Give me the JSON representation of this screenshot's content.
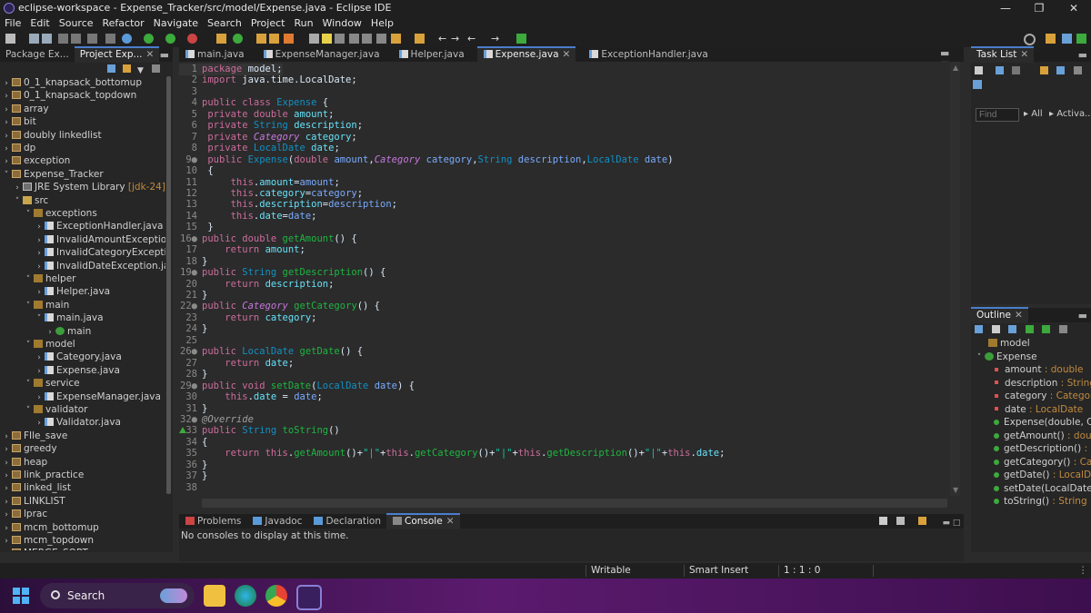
{
  "window": {
    "title": "eclipse-workspace - Expense_Tracker/src/model/Expense.java - Eclipse IDE"
  },
  "menu": [
    "File",
    "Edit",
    "Source",
    "Refactor",
    "Navigate",
    "Search",
    "Project",
    "Run",
    "Window",
    "Help"
  ],
  "left_tabs": {
    "package_explorer": "Package Ex...",
    "project_explorer": "Project Exp..."
  },
  "tree": [
    {
      "indent": 0,
      "chev": ">",
      "icon": "proj",
      "label": "0_1_knapsack_bottomup"
    },
    {
      "indent": 0,
      "chev": ">",
      "icon": "proj",
      "label": "0_1_knapsack_topdown"
    },
    {
      "indent": 0,
      "chev": ">",
      "icon": "proj",
      "label": "array"
    },
    {
      "indent": 0,
      "chev": ">",
      "icon": "proj",
      "label": "bit"
    },
    {
      "indent": 0,
      "chev": ">",
      "icon": "proj",
      "label": "doubly linkedlist"
    },
    {
      "indent": 0,
      "chev": ">",
      "icon": "proj",
      "label": "dp"
    },
    {
      "indent": 0,
      "chev": ">",
      "icon": "proj",
      "label": "exception"
    },
    {
      "indent": 0,
      "chev": "v",
      "icon": "proj",
      "label": "Expense_Tracker"
    },
    {
      "indent": 1,
      "chev": ">",
      "icon": "lib",
      "label": "JRE System Library",
      "extra": " [jdk-24]"
    },
    {
      "indent": 1,
      "chev": "v",
      "icon": "folder",
      "label": "src"
    },
    {
      "indent": 2,
      "chev": "v",
      "icon": "pkg",
      "label": "exceptions"
    },
    {
      "indent": 3,
      "chev": ">",
      "icon": "java",
      "label": "ExceptionHandler.java"
    },
    {
      "indent": 3,
      "chev": ">",
      "icon": "java",
      "label": "InvalidAmountException.jav"
    },
    {
      "indent": 3,
      "chev": ">",
      "icon": "java",
      "label": "InvalidCategoryException.ja"
    },
    {
      "indent": 3,
      "chev": ">",
      "icon": "java",
      "label": "InvalidDateException.java"
    },
    {
      "indent": 2,
      "chev": "v",
      "icon": "pkg",
      "label": "helper"
    },
    {
      "indent": 3,
      "chev": ">",
      "icon": "java",
      "label": "Helper.java"
    },
    {
      "indent": 2,
      "chev": "v",
      "icon": "pkg",
      "label": "main"
    },
    {
      "indent": 3,
      "chev": "v",
      "icon": "java",
      "label": "main.java"
    },
    {
      "indent": 4,
      "chev": ">",
      "icon": "cls",
      "label": "main"
    },
    {
      "indent": 2,
      "chev": "v",
      "icon": "pkg",
      "label": "model"
    },
    {
      "indent": 3,
      "chev": ">",
      "icon": "java",
      "label": "Category.java"
    },
    {
      "indent": 3,
      "chev": ">",
      "icon": "java",
      "label": "Expense.java"
    },
    {
      "indent": 2,
      "chev": "v",
      "icon": "pkg",
      "label": "service"
    },
    {
      "indent": 3,
      "chev": ">",
      "icon": "java",
      "label": "ExpenseManager.java"
    },
    {
      "indent": 2,
      "chev": "v",
      "icon": "pkg",
      "label": "validator"
    },
    {
      "indent": 3,
      "chev": ">",
      "icon": "java",
      "label": "Validator.java"
    },
    {
      "indent": 0,
      "chev": ">",
      "icon": "proj",
      "label": "FIle_save"
    },
    {
      "indent": 0,
      "chev": ">",
      "icon": "proj",
      "label": "greedy"
    },
    {
      "indent": 0,
      "chev": ">",
      "icon": "proj",
      "label": "heap"
    },
    {
      "indent": 0,
      "chev": ">",
      "icon": "proj",
      "label": "link_practice"
    },
    {
      "indent": 0,
      "chev": ">",
      "icon": "proj",
      "label": "linked_list"
    },
    {
      "indent": 0,
      "chev": ">",
      "icon": "proj",
      "label": "LINKLIST"
    },
    {
      "indent": 0,
      "chev": ">",
      "icon": "proj",
      "label": "lprac"
    },
    {
      "indent": 0,
      "chev": ">",
      "icon": "proj",
      "label": "mcm_bottomup"
    },
    {
      "indent": 0,
      "chev": ">",
      "icon": "proj",
      "label": "mcm_topdown"
    },
    {
      "indent": 0,
      "chev": ">",
      "icon": "proj",
      "label": "MERGE_SORT"
    }
  ],
  "editor_tabs": [
    {
      "label": "main.java",
      "active": false
    },
    {
      "label": "ExpenseManager.java",
      "active": false
    },
    {
      "label": "Helper.java",
      "active": false
    },
    {
      "label": "Expense.java",
      "active": true
    },
    {
      "label": "ExceptionHandler.java",
      "active": false
    }
  ],
  "code": [
    {
      "n": "1",
      "t": [
        [
          "kw",
          "package"
        ],
        [
          "pln",
          " model;"
        ]
      ]
    },
    {
      "n": "2",
      "t": [
        [
          "kw",
          "import"
        ],
        [
          "pln",
          " java.time.LocalDate;"
        ]
      ]
    },
    {
      "n": "3",
      "t": []
    },
    {
      "n": "4",
      "t": [
        [
          "kw",
          "public class"
        ],
        [
          "pln",
          " "
        ],
        [
          "ty",
          "Expense"
        ],
        [
          "pln",
          " {"
        ]
      ]
    },
    {
      "n": "5",
      "t": [
        [
          "pln",
          " "
        ],
        [
          "kw",
          "private double"
        ],
        [
          "pln",
          " "
        ],
        [
          "fld",
          "amount"
        ],
        [
          "pln",
          ";"
        ]
      ]
    },
    {
      "n": "6",
      "t": [
        [
          "pln",
          " "
        ],
        [
          "kw",
          "private"
        ],
        [
          "pln",
          " "
        ],
        [
          "ty",
          "String"
        ],
        [
          "pln",
          " "
        ],
        [
          "fld",
          "description"
        ],
        [
          "pln",
          ";"
        ]
      ]
    },
    {
      "n": "7",
      "t": [
        [
          "pln",
          " "
        ],
        [
          "kw",
          "private"
        ],
        [
          "pln",
          " "
        ],
        [
          "tyi",
          "Category"
        ],
        [
          "pln",
          " "
        ],
        [
          "fld",
          "category"
        ],
        [
          "pln",
          ";"
        ]
      ]
    },
    {
      "n": "8",
      "t": [
        [
          "pln",
          " "
        ],
        [
          "kw",
          "private"
        ],
        [
          "pln",
          " "
        ],
        [
          "ty",
          "LocalDate"
        ],
        [
          "pln",
          " "
        ],
        [
          "fld",
          "date"
        ],
        [
          "pln",
          ";"
        ]
      ]
    },
    {
      "n": "9●",
      "t": [
        [
          "pln",
          " "
        ],
        [
          "kw",
          "public"
        ],
        [
          "pln",
          " "
        ],
        [
          "ty",
          "Expense"
        ],
        [
          "pln",
          "("
        ],
        [
          "kw",
          "double"
        ],
        [
          "pln",
          " "
        ],
        [
          "par",
          "amount"
        ],
        [
          "pln",
          ","
        ],
        [
          "tyi",
          "Category"
        ],
        [
          "pln",
          " "
        ],
        [
          "par",
          "category"
        ],
        [
          "pln",
          ","
        ],
        [
          "ty",
          "String"
        ],
        [
          "pln",
          " "
        ],
        [
          "par",
          "description"
        ],
        [
          "pln",
          ","
        ],
        [
          "ty",
          "LocalDate"
        ],
        [
          "pln",
          " "
        ],
        [
          "par",
          "date"
        ],
        [
          "pln",
          ")"
        ]
      ]
    },
    {
      "n": "10",
      "t": [
        [
          "pln",
          " {"
        ]
      ]
    },
    {
      "n": "11",
      "t": [
        [
          "pln",
          "     "
        ],
        [
          "kw",
          "this"
        ],
        [
          "pln",
          "."
        ],
        [
          "fld",
          "amount"
        ],
        [
          "pln",
          "="
        ],
        [
          "par",
          "amount"
        ],
        [
          "pln",
          ";"
        ]
      ]
    },
    {
      "n": "12",
      "t": [
        [
          "pln",
          "     "
        ],
        [
          "kw",
          "this"
        ],
        [
          "pln",
          "."
        ],
        [
          "fld",
          "category"
        ],
        [
          "pln",
          "="
        ],
        [
          "par",
          "category"
        ],
        [
          "pln",
          ";"
        ]
      ]
    },
    {
      "n": "13",
      "t": [
        [
          "pln",
          "     "
        ],
        [
          "kw",
          "this"
        ],
        [
          "pln",
          "."
        ],
        [
          "fld",
          "description"
        ],
        [
          "pln",
          "="
        ],
        [
          "par",
          "description"
        ],
        [
          "pln",
          ";"
        ]
      ]
    },
    {
      "n": "14",
      "t": [
        [
          "pln",
          "     "
        ],
        [
          "kw",
          "this"
        ],
        [
          "pln",
          "."
        ],
        [
          "fld",
          "date"
        ],
        [
          "pln",
          "="
        ],
        [
          "par",
          "date"
        ],
        [
          "pln",
          ";"
        ]
      ]
    },
    {
      "n": "15",
      "t": [
        [
          "pln",
          " }"
        ]
      ]
    },
    {
      "n": "16●",
      "t": [
        [
          "kw",
          "public double"
        ],
        [
          "pln",
          " "
        ],
        [
          "mth",
          "getAmount"
        ],
        [
          "pln",
          "() {"
        ]
      ]
    },
    {
      "n": "17",
      "t": [
        [
          "pln",
          "    "
        ],
        [
          "kw",
          "return"
        ],
        [
          "pln",
          " "
        ],
        [
          "fld",
          "amount"
        ],
        [
          "pln",
          ";"
        ]
      ]
    },
    {
      "n": "18",
      "t": [
        [
          "pln",
          "}"
        ]
      ]
    },
    {
      "n": "19●",
      "t": [
        [
          "kw",
          "public"
        ],
        [
          "pln",
          " "
        ],
        [
          "ty",
          "String"
        ],
        [
          "pln",
          " "
        ],
        [
          "mth",
          "getDescription"
        ],
        [
          "pln",
          "() {"
        ]
      ]
    },
    {
      "n": "20",
      "t": [
        [
          "pln",
          "    "
        ],
        [
          "kw",
          "return"
        ],
        [
          "pln",
          " "
        ],
        [
          "fld",
          "description"
        ],
        [
          "pln",
          ";"
        ]
      ]
    },
    {
      "n": "21",
      "t": [
        [
          "pln",
          "}"
        ]
      ]
    },
    {
      "n": "22●",
      "t": [
        [
          "kw",
          "public"
        ],
        [
          "pln",
          " "
        ],
        [
          "tyi",
          "Category"
        ],
        [
          "pln",
          " "
        ],
        [
          "mth",
          "getCategory"
        ],
        [
          "pln",
          "() {"
        ]
      ]
    },
    {
      "n": "23",
      "t": [
        [
          "pln",
          "    "
        ],
        [
          "kw",
          "return"
        ],
        [
          "pln",
          " "
        ],
        [
          "fld",
          "category"
        ],
        [
          "pln",
          ";"
        ]
      ]
    },
    {
      "n": "24",
      "t": [
        [
          "pln",
          "}"
        ]
      ]
    },
    {
      "n": "25",
      "t": []
    },
    {
      "n": "26●",
      "t": [
        [
          "kw",
          "public"
        ],
        [
          "pln",
          " "
        ],
        [
          "ty",
          "LocalDate"
        ],
        [
          "pln",
          " "
        ],
        [
          "mth",
          "getDate"
        ],
        [
          "pln",
          "() {"
        ]
      ]
    },
    {
      "n": "27",
      "t": [
        [
          "pln",
          "    "
        ],
        [
          "kw",
          "return"
        ],
        [
          "pln",
          " "
        ],
        [
          "fld",
          "date"
        ],
        [
          "pln",
          ";"
        ]
      ]
    },
    {
      "n": "28",
      "t": [
        [
          "pln",
          "}"
        ]
      ]
    },
    {
      "n": "29●",
      "t": [
        [
          "kw",
          "public void"
        ],
        [
          "pln",
          " "
        ],
        [
          "mth",
          "setDate"
        ],
        [
          "pln",
          "("
        ],
        [
          "ty",
          "LocalDate"
        ],
        [
          "pln",
          " "
        ],
        [
          "par",
          "date"
        ],
        [
          "pln",
          ") {"
        ]
      ]
    },
    {
      "n": "30",
      "t": [
        [
          "pln",
          "    "
        ],
        [
          "kw",
          "this"
        ],
        [
          "pln",
          "."
        ],
        [
          "fld",
          "date"
        ],
        [
          "pln",
          " = "
        ],
        [
          "par",
          "date"
        ],
        [
          "pln",
          ";"
        ]
      ]
    },
    {
      "n": "31",
      "t": [
        [
          "pln",
          "}"
        ]
      ]
    },
    {
      "n": "32●",
      "t": [
        [
          "ann",
          "@Override"
        ]
      ]
    },
    {
      "n": "33",
      "t": [
        [
          "kw",
          "public"
        ],
        [
          "pln",
          " "
        ],
        [
          "ty",
          "String"
        ],
        [
          "pln",
          " "
        ],
        [
          "mth",
          "toString"
        ],
        [
          "pln",
          "()"
        ]
      ]
    },
    {
      "n": "34",
      "t": [
        [
          "pln",
          "{"
        ]
      ]
    },
    {
      "n": "35",
      "t": [
        [
          "pln",
          "    "
        ],
        [
          "kw",
          "return"
        ],
        [
          "pln",
          " "
        ],
        [
          "kw",
          "this"
        ],
        [
          "pln",
          "."
        ],
        [
          "mth",
          "getAmount"
        ],
        [
          "pln",
          "()+"
        ],
        [
          "str",
          "\"|\""
        ],
        [
          "pln",
          "+"
        ],
        [
          "kw",
          "this"
        ],
        [
          "pln",
          "."
        ],
        [
          "mth",
          "getCategory"
        ],
        [
          "pln",
          "()+"
        ],
        [
          "str",
          "\"|\""
        ],
        [
          "pln",
          "+"
        ],
        [
          "kw",
          "this"
        ],
        [
          "pln",
          "."
        ],
        [
          "mth",
          "getDescription"
        ],
        [
          "pln",
          "()+"
        ],
        [
          "str",
          "\"|\""
        ],
        [
          "pln",
          "+"
        ],
        [
          "kw",
          "this"
        ],
        [
          "pln",
          "."
        ],
        [
          "fld",
          "date"
        ],
        [
          "pln",
          ";"
        ]
      ]
    },
    {
      "n": "36",
      "t": [
        [
          "pln",
          "}"
        ]
      ]
    },
    {
      "n": "37",
      "t": [
        [
          "pln",
          "}"
        ]
      ]
    },
    {
      "n": "38",
      "t": []
    }
  ],
  "bottom_tabs": [
    {
      "label": "Problems",
      "active": false
    },
    {
      "label": "Javadoc",
      "active": false
    },
    {
      "label": "Declaration",
      "active": false
    },
    {
      "label": "Console",
      "active": true
    }
  ],
  "console_message": "No consoles to display at this time.",
  "task_list": {
    "tab": "Task List",
    "find_placeholder": "Find",
    "all": "All",
    "activate": "Activa..."
  },
  "outline": {
    "tab": "Outline",
    "items": [
      {
        "kind": "pkg",
        "name": "model",
        "type": "",
        "indent": 0
      },
      {
        "kind": "class",
        "name": "Expense",
        "type": "",
        "indent": 0
      },
      {
        "kind": "field",
        "name": "amount",
        "type": " : double",
        "indent": 1
      },
      {
        "kind": "field",
        "name": "description",
        "type": " : String",
        "indent": 1
      },
      {
        "kind": "field",
        "name": "category",
        "type": " : Category",
        "indent": 1
      },
      {
        "kind": "field",
        "name": "date",
        "type": " : LocalDate",
        "indent": 1
      },
      {
        "kind": "ctor",
        "name": "Expense(double, Cate",
        "type": "",
        "indent": 1
      },
      {
        "kind": "method",
        "name": "getAmount()",
        "type": " : double",
        "indent": 1
      },
      {
        "kind": "method",
        "name": "getDescription()",
        "type": " : Str",
        "indent": 1
      },
      {
        "kind": "method",
        "name": "getCategory()",
        "type": " : Categ",
        "indent": 1
      },
      {
        "kind": "method",
        "name": "getDate()",
        "type": " : LocalDat",
        "indent": 1
      },
      {
        "kind": "method",
        "name": "setDate(LocalDate)",
        "type": " :",
        "indent": 1
      },
      {
        "kind": "override",
        "name": "toString()",
        "type": " : String",
        "indent": 1
      }
    ]
  },
  "status": {
    "writable": "Writable",
    "insert_mode": "Smart Insert",
    "position": "1 : 1 : 0"
  },
  "taskbar": {
    "search_label": "Search"
  },
  "colors": {
    "accent": "#4a7ecb",
    "editor_bg": "#2b2b2b",
    "keyword": "#cc6c9c"
  }
}
